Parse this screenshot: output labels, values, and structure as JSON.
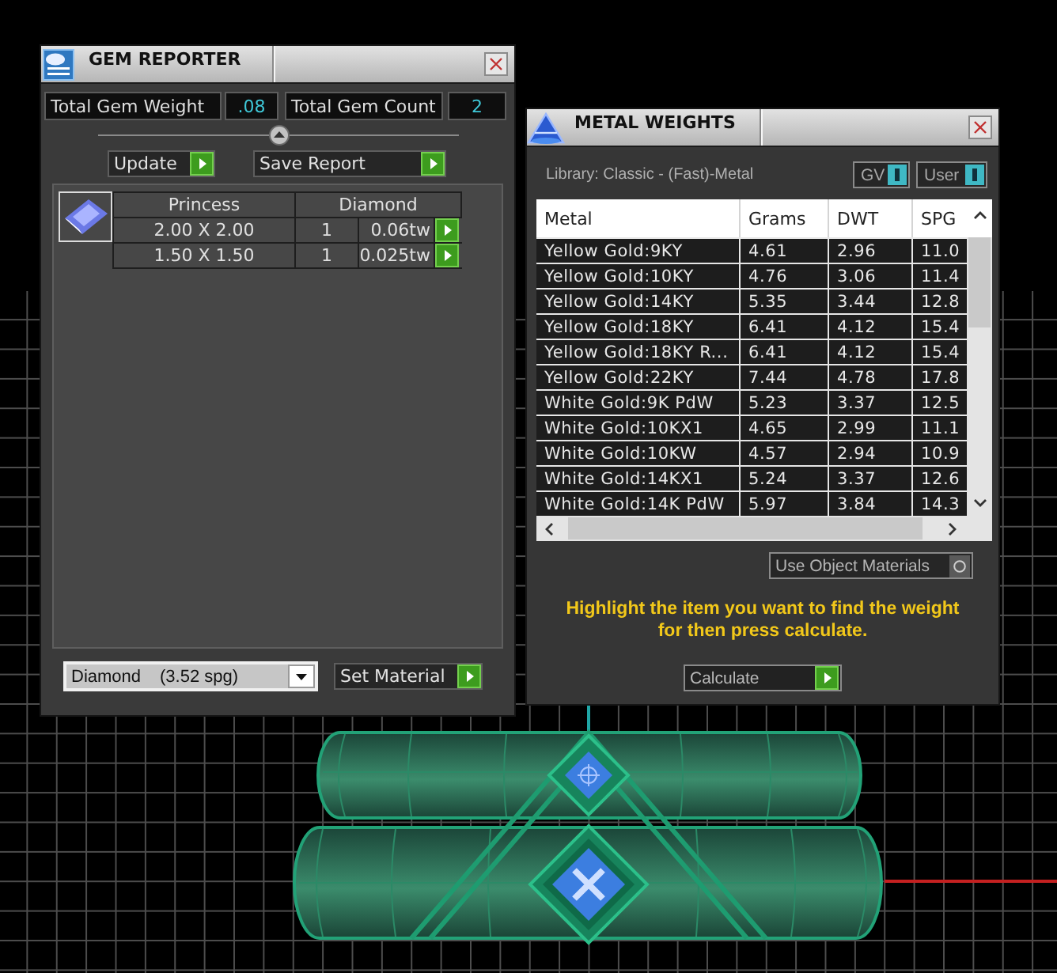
{
  "gem_reporter": {
    "title": "GEM REPORTER",
    "total_weight": {
      "label": "Total Gem Weight",
      "value": ".08"
    },
    "total_count": {
      "label": "Total Gem Count",
      "value": "2"
    },
    "buttons": [
      {
        "label": "Update"
      },
      {
        "label": "Save Report"
      }
    ],
    "gem_group": {
      "columns": [
        "Princess",
        "Diamond"
      ],
      "rows": [
        {
          "size": "2.00 X 2.00",
          "count": "1",
          "weight": "0.06tw"
        },
        {
          "size": "1.50 X 1.50",
          "count": "1",
          "weight": "0.025tw"
        }
      ]
    },
    "material": {
      "name": "Diamond",
      "spg": "(3.52 spg)"
    },
    "set_button": "Set Material"
  },
  "metal_weights": {
    "title": "METAL WEIGHTS",
    "library": "Library: Classic - (Fast)-Metal",
    "toggles": [
      {
        "label": "GV",
        "on": true
      },
      {
        "label": "User",
        "on": true
      }
    ],
    "table": {
      "columns": [
        "Metal",
        "Grams",
        "DWT",
        "SPG"
      ],
      "rows": [
        {
          "metal": "Yellow Gold:9KY",
          "grams": "4.61",
          "dwt": "2.96",
          "spg": "11.0",
          "selected": false
        },
        {
          "metal": "Yellow Gold:10KY",
          "grams": "4.76",
          "dwt": "3.06",
          "spg": "11.4",
          "selected": false
        },
        {
          "metal": "Yellow Gold:14KY",
          "grams": "5.35",
          "dwt": "3.44",
          "spg": "12.8",
          "selected": false
        },
        {
          "metal": "Yellow Gold:18KY",
          "grams": "6.41",
          "dwt": "4.12",
          "spg": "15.4",
          "selected": false
        },
        {
          "metal": "Yellow Gold:18KY R...",
          "grams": "6.41",
          "dwt": "4.12",
          "spg": "15.4",
          "selected": false
        },
        {
          "metal": "Yellow Gold:22KY",
          "grams": "7.44",
          "dwt": "4.78",
          "spg": "17.8",
          "selected": false
        },
        {
          "metal": "White Gold:9K PdW",
          "grams": "5.23",
          "dwt": "3.37",
          "spg": "12.5",
          "selected": false
        },
        {
          "metal": "White Gold:10KX1",
          "grams": "4.65",
          "dwt": "2.99",
          "spg": "11.1",
          "selected": false
        },
        {
          "metal": "White Gold:10KW",
          "grams": "4.57",
          "dwt": "2.94",
          "spg": "10.9",
          "selected": false
        },
        {
          "metal": "White Gold:14KX1",
          "grams": "5.24",
          "dwt": "3.37",
          "spg": "12.6",
          "selected": false
        },
        {
          "metal": "White Gold:14K PdW",
          "grams": "5.97",
          "dwt": "3.84",
          "spg": "14.3",
          "selected": false
        }
      ]
    },
    "use_object_materials": {
      "label": "Use Object Materials",
      "on": false
    },
    "hint": "Highlight the item you want to find the weight for then press calculate.",
    "calculate_button": "Calculate"
  }
}
